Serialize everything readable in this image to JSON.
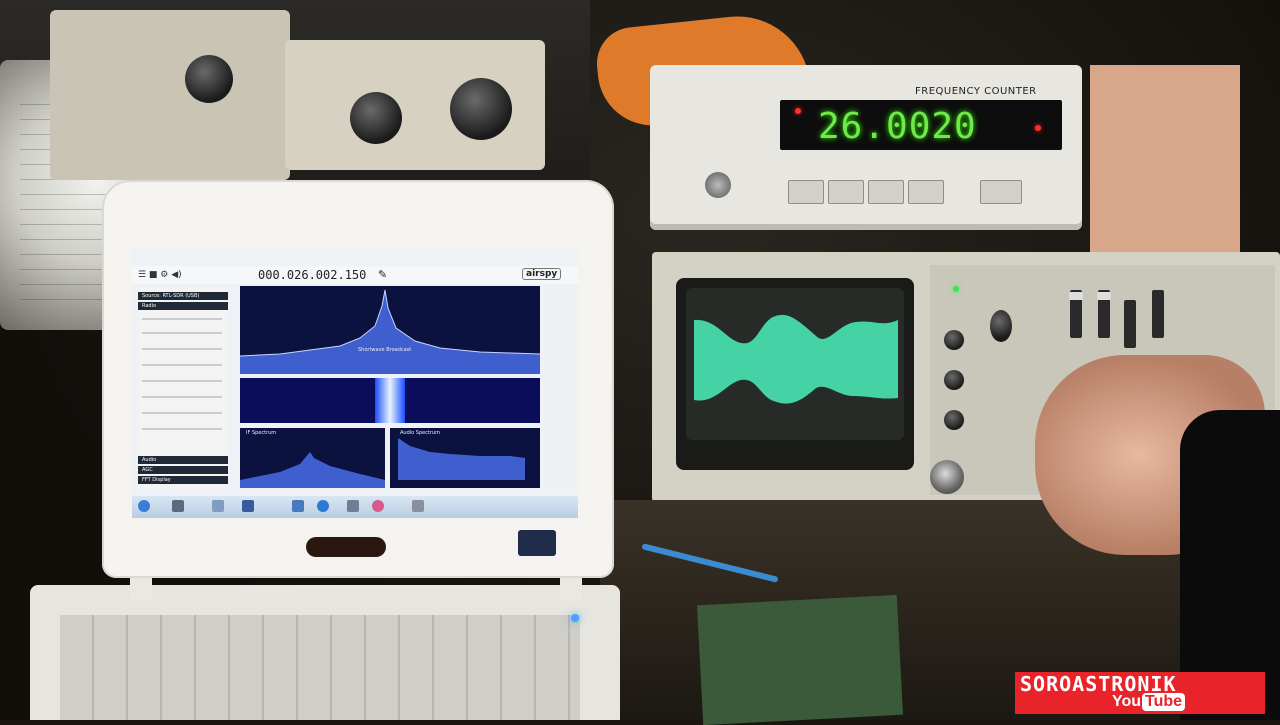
{
  "frequency_counter": {
    "brand": "",
    "label": "FREQUENCY COUNTER",
    "digits": "26.0020"
  },
  "sdr_app": {
    "frequency": "000.026.002.150",
    "brand_badge": "airspy",
    "spectrum_annotation": "Shortwave Broadcast",
    "if_label": "IF Spectrum",
    "audio_label": "Audio Spectrum",
    "sidebar_sections": [
      "Source: RTL-SDR (USB)",
      "Radio",
      "Audio",
      "AGC",
      "FFT Display"
    ]
  },
  "watermark": {
    "title": "SOROASTRONIK",
    "you": "You",
    "tube": "Tube"
  },
  "colors": {
    "counter_digit": "#73e84e",
    "scope_trace": "#49e6b4",
    "watermark_bg": "#e8242a",
    "spectrum_bg": "#0c1240"
  }
}
